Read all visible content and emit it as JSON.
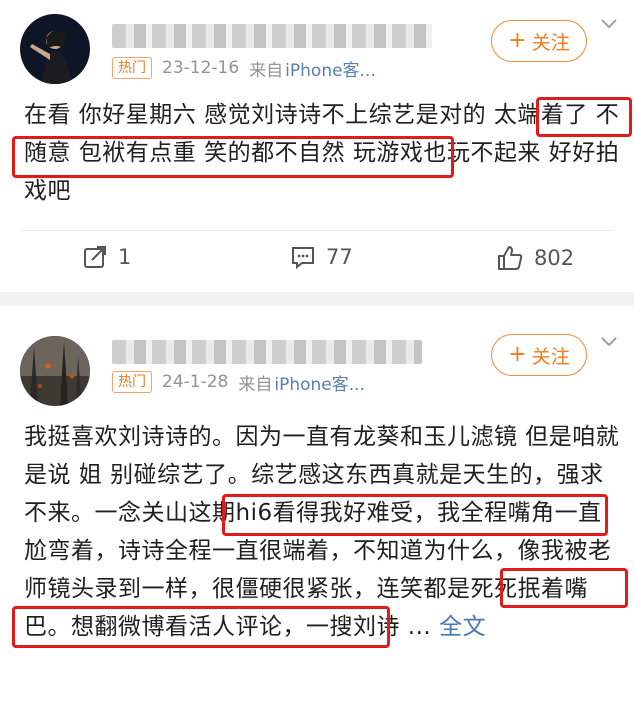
{
  "posts": [
    {
      "badge": "热门",
      "time": "23-12-16",
      "source_prefix": "来自",
      "source_device": "iPhone客...",
      "follow_label": "关注",
      "text": "在看 你好星期六 感觉刘诗诗不上综艺是对的 太端着了 不随意 包袱有点重 笑的都不自然 玩游戏也玩不起来 好好拍戏吧",
      "more_link": "",
      "highlights": [
        "太端着了 不随意 包袱有点重 笑的都不自然"
      ],
      "repost_count": "1",
      "comment_count": "77",
      "like_count": "802"
    },
    {
      "badge": "热门",
      "time": "24-1-28",
      "source_prefix": "来自",
      "source_device": "iPhone客...",
      "follow_label": "关注",
      "text": "我挺喜欢刘诗诗的。因为一直有龙葵和玉儿滤镜 但是咱就是说 姐 别碰综艺了。综艺感这东西真就是天生的，强求不来。一念关山这期hi6看得我好难受，我全程嘴角一直尬弯着，诗诗全程一直很端着，不知道为什么，像我被老师镜头录到一样，很僵硬很紧张，连笑都是死死抿着嘴巴。想翻微博看活人评论，一搜刘诗 ... ",
      "more_link": "全文",
      "highlights": [
        "一念关山这期hi6看得我好难受，",
        "很僵硬很紧张，连笑都是死死抿着嘴巴。"
      ]
    }
  ],
  "colors": {
    "accent_orange": "#f07c1d",
    "highlight_red": "#e31a1a",
    "link_blue": "#4a76b8"
  },
  "icons": [
    "repost-icon",
    "comment-icon",
    "like-icon",
    "chevron-down-icon"
  ]
}
